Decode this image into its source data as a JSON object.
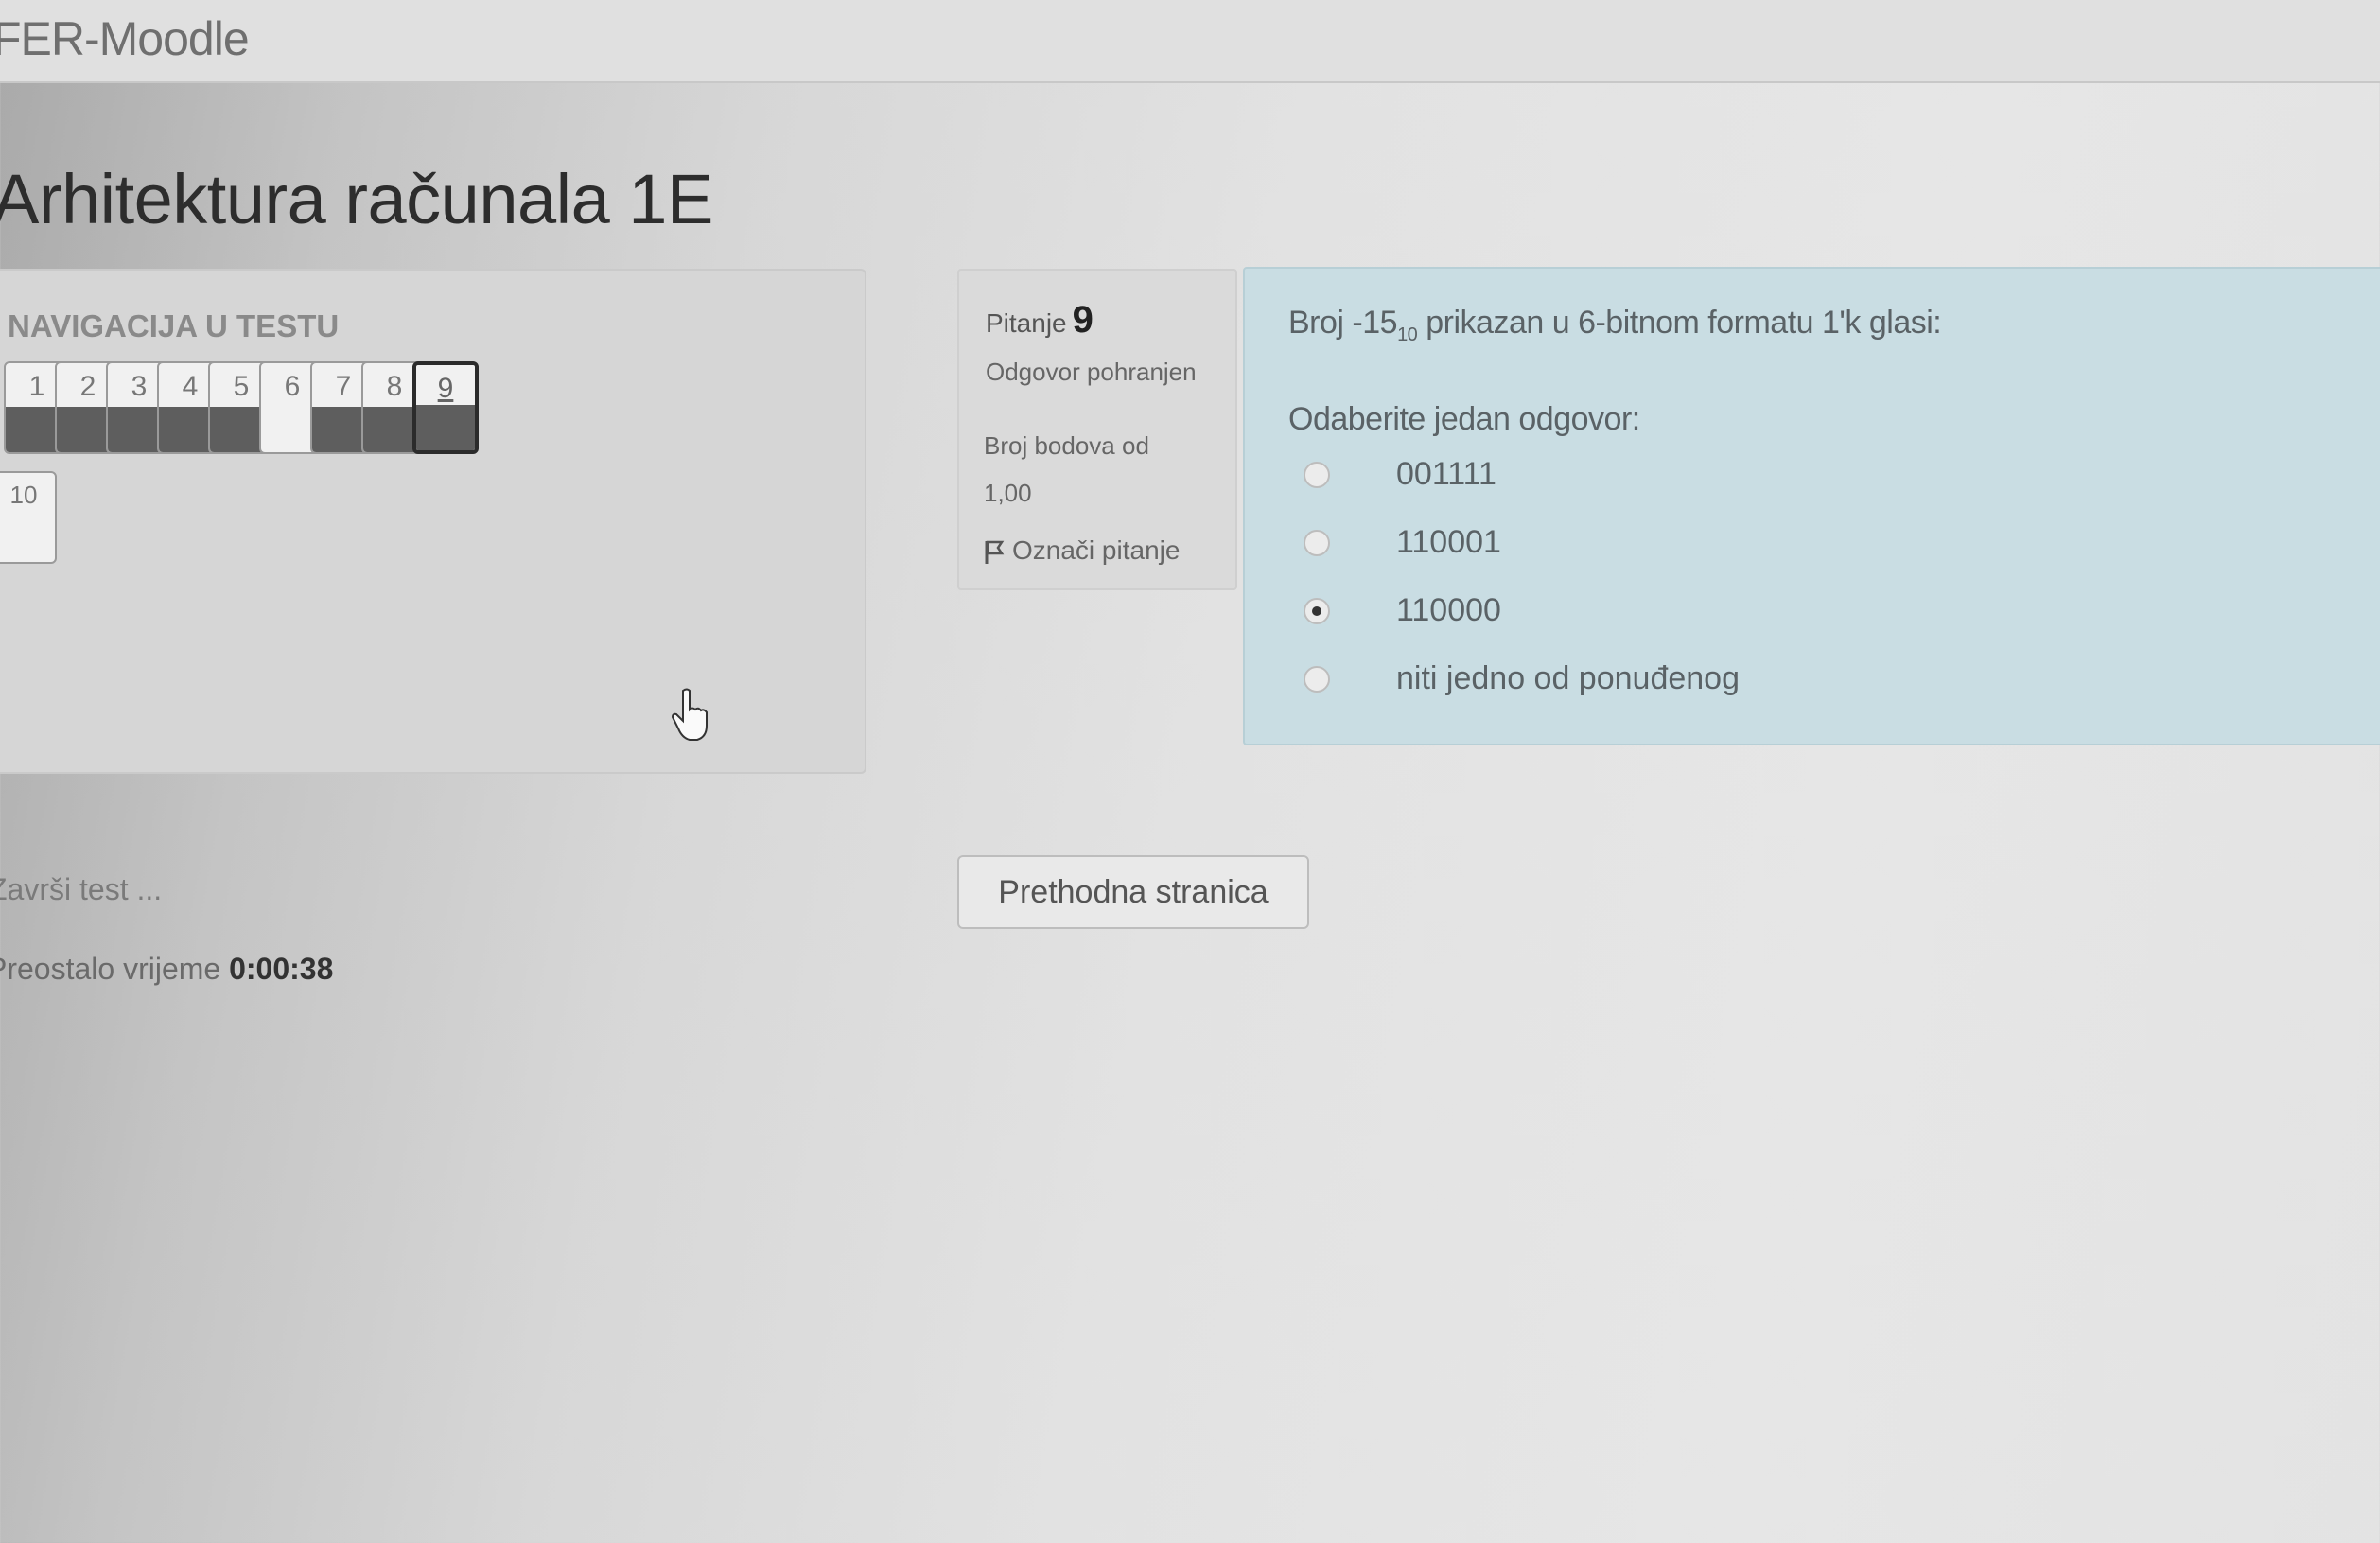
{
  "site": {
    "brand": "FER-Moodle"
  },
  "course": {
    "title": "Arhitektura računala 1E"
  },
  "navigation": {
    "heading": "NAVIGACIJA U TESTU",
    "questions": [
      {
        "label": "1",
        "status": "answered"
      },
      {
        "label": "2",
        "status": "answered"
      },
      {
        "label": "3",
        "status": "answered"
      },
      {
        "label": "4",
        "status": "answered"
      },
      {
        "label": "5",
        "status": "answered"
      },
      {
        "label": "6",
        "status": "not-answered"
      },
      {
        "label": "7",
        "status": "answered"
      },
      {
        "label": "8",
        "status": "answered"
      },
      {
        "label": "9",
        "status": "answered-current"
      },
      {
        "label": "10",
        "status": "not-answered"
      }
    ],
    "finish_link": "Završi test ...",
    "time_left_label": "Preostalo vrijeme",
    "time_left_value": "0:00:38"
  },
  "question_info": {
    "label": "Pitanje",
    "number": "9",
    "state": "Odgovor pohranjen",
    "marks_label": "Broj bodova od",
    "marks_value": "1,00",
    "flag_label": "Označi pitanje"
  },
  "question": {
    "text_before": "Broj -15",
    "subscript": "10",
    "text_after": " prikazan u 6-bitnom formatu 1'k glasi:",
    "prompt": "Odaberite jedan odgovor:",
    "options": [
      {
        "label": "001111",
        "selected": false
      },
      {
        "label": "110001",
        "selected": false
      },
      {
        "label": "110000",
        "selected": true
      },
      {
        "label": "niti jedno od ponuđenog",
        "selected": false
      }
    ]
  },
  "buttons": {
    "previous_page": "Prethodna stranica"
  },
  "colors": {
    "content_bg": "#c9dde3",
    "answered_fill": "#5e5e5e"
  }
}
